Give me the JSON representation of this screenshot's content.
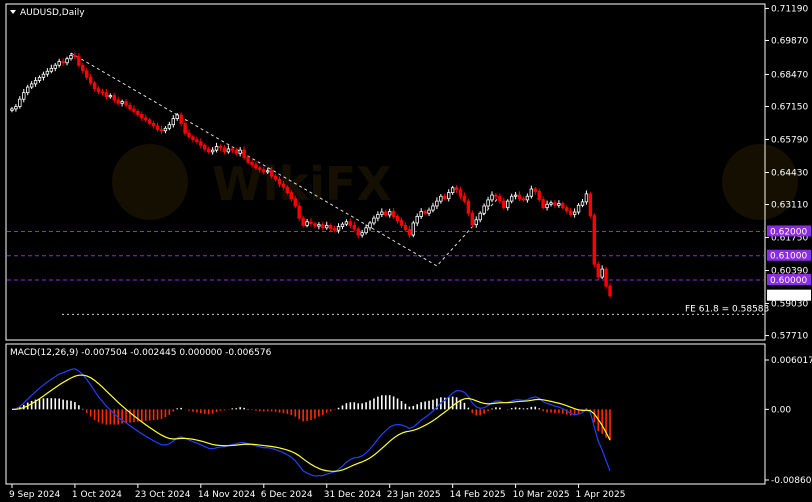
{
  "window": {
    "symbol_title": "AUDUSD,Daily",
    "indicator_title": "MACD(12,26,9) -0.007504 -0.002445 0.000000 -0.006576"
  },
  "colors": {
    "background": "#000000",
    "frame": "#ffffff",
    "bull_candle": "#ffffff",
    "bear_candle": "#ff0000",
    "level_line": "#8b2be2",
    "level_label_bg": "#8b2be2",
    "current_price_bg": "#ffffff",
    "macd_line": "#2040ff",
    "signal_line": "#ffff33",
    "histogram_positive": "#ffffff",
    "histogram_negative": "#ff2a00",
    "fibo_line": "#cccccc"
  },
  "chart_data": [
    {
      "type": "candlestick",
      "title": "AUDUSD,Daily",
      "x_tick_labels": [
        "9 Sep 2024",
        "1 Oct 2024",
        "23 Oct 2024",
        "14 Nov 2024",
        "6 Dec 2024",
        "31 Dec 2024",
        "23 Jan 2025",
        "14 Feb 2025",
        "10 Mar 2025",
        "1 Apr 2025"
      ],
      "y_tick_labels": [
        "0.71190",
        "0.69870",
        "0.68470",
        "0.67150",
        "0.65790",
        "0.64430",
        "0.63110",
        "0.61750",
        "0.60390",
        "0.59030",
        "0.57710"
      ],
      "ylim": [
        0.5761,
        0.7129
      ],
      "horizontal_levels": [
        {
          "value": 0.62,
          "label": "0.62000"
        },
        {
          "value": 0.61,
          "label": "0.61000"
        },
        {
          "value": 0.6,
          "label": "0.60000"
        }
      ],
      "current_price": {
        "value": 0.59354,
        "label": "0.59354"
      },
      "fibo_expansion": {
        "label": "FE 61.8 = 0.58583",
        "value": 0.58583
      },
      "close_series": [
        0.6705,
        0.6715,
        0.6745,
        0.6772,
        0.6795,
        0.6808,
        0.6822,
        0.6835,
        0.6848,
        0.686,
        0.6872,
        0.6885,
        0.69,
        0.6895,
        0.6912,
        0.6925,
        0.692,
        0.6885,
        0.6862,
        0.6835,
        0.6812,
        0.6788,
        0.6775,
        0.6772,
        0.6755,
        0.676,
        0.6742,
        0.6728,
        0.6735,
        0.672,
        0.6705,
        0.6695,
        0.6682,
        0.6668,
        0.666,
        0.6645,
        0.6635,
        0.662,
        0.6615,
        0.6625,
        0.664,
        0.6665,
        0.668,
        0.6645,
        0.6605,
        0.659,
        0.6578,
        0.657,
        0.6555,
        0.654,
        0.6528,
        0.6535,
        0.655,
        0.6545,
        0.6528,
        0.654,
        0.6535,
        0.6522,
        0.6535,
        0.6505,
        0.6485,
        0.6475,
        0.6462,
        0.6455,
        0.6445,
        0.645,
        0.6428,
        0.6415,
        0.6395,
        0.6382,
        0.636,
        0.6335,
        0.6305,
        0.6255,
        0.6225,
        0.624,
        0.6232,
        0.6222,
        0.6228,
        0.6215,
        0.6225,
        0.6212,
        0.6205,
        0.622,
        0.623,
        0.624,
        0.6225,
        0.621,
        0.6185,
        0.6195,
        0.6215,
        0.6235,
        0.6255,
        0.627,
        0.628,
        0.6268,
        0.6282,
        0.6262,
        0.6245,
        0.6225,
        0.6208,
        0.6185,
        0.6235,
        0.6262,
        0.6282,
        0.6275,
        0.6288,
        0.6305,
        0.6325,
        0.6345,
        0.6335,
        0.636,
        0.638,
        0.6372,
        0.6345,
        0.6325,
        0.6275,
        0.6228,
        0.6248,
        0.6275,
        0.6305,
        0.633,
        0.635,
        0.6345,
        0.6325,
        0.6298,
        0.6325,
        0.6345,
        0.635,
        0.6335,
        0.633,
        0.6345,
        0.6375,
        0.6365,
        0.6332,
        0.6298,
        0.6312,
        0.6318,
        0.6308,
        0.6315,
        0.6298,
        0.6285,
        0.627,
        0.628,
        0.6308,
        0.6322,
        0.6355,
        0.6265,
        0.6065,
        0.6012,
        0.6045,
        0.5975,
        0.5935
      ],
      "macd": {
        "ylim": [
          -0.008609,
          0.006017
        ],
        "y_tick_labels": [
          "0.006017",
          "0.00",
          "-0.008609"
        ],
        "values": {
          "macd": -0.007504,
          "signal": -0.002445,
          "level": 0.0,
          "histogram": -0.006576
        }
      }
    }
  ]
}
